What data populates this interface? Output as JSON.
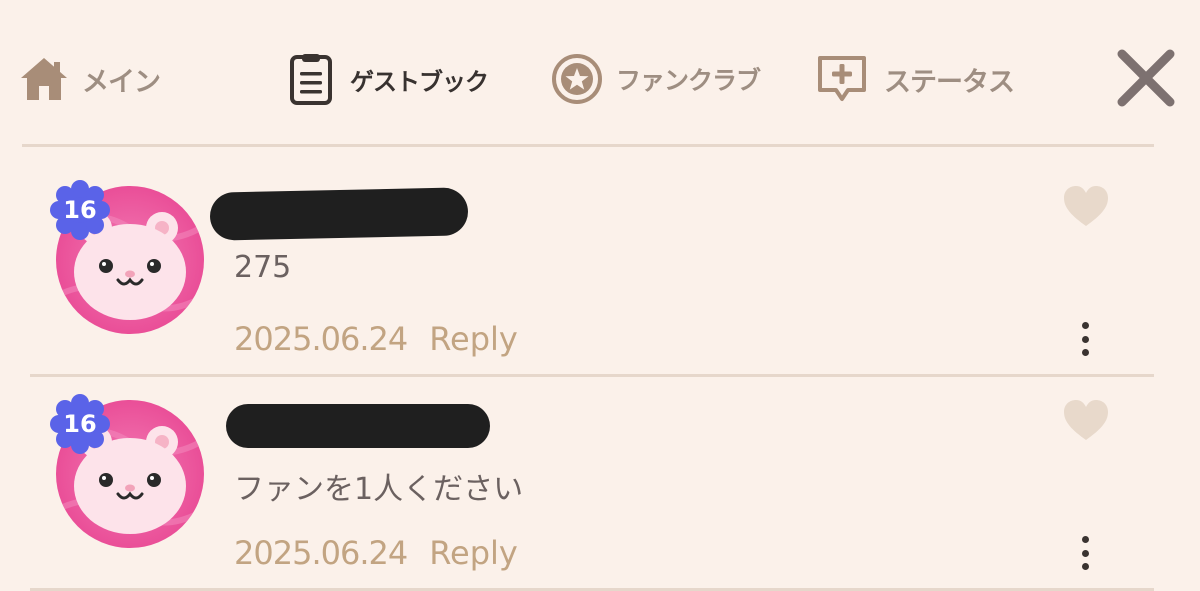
{
  "nav": {
    "tabs": [
      {
        "label": "メイン",
        "icon": "home-icon"
      },
      {
        "label": "ゲストブック",
        "icon": "guestbook-icon",
        "active": true
      },
      {
        "label": "ファンクラブ",
        "icon": "star-badge-icon"
      },
      {
        "label": "ステータス",
        "icon": "add-status-icon"
      }
    ],
    "close_icon": "close-icon"
  },
  "comments": [
    {
      "level": "16",
      "message": "275",
      "date": "2025.06.24",
      "reply_label": "Reply"
    },
    {
      "level": "16",
      "message": "ファンを1人ください",
      "date": "2025.06.24",
      "reply_label": "Reply"
    }
  ],
  "colors": {
    "background": "#fbf1ea",
    "active_tab": "#383230",
    "inactive_tab": "#9e8e82",
    "meta_text": "#c2a482",
    "level_badge": "#5a63e8",
    "avatar_ring": "#ea4f98"
  }
}
